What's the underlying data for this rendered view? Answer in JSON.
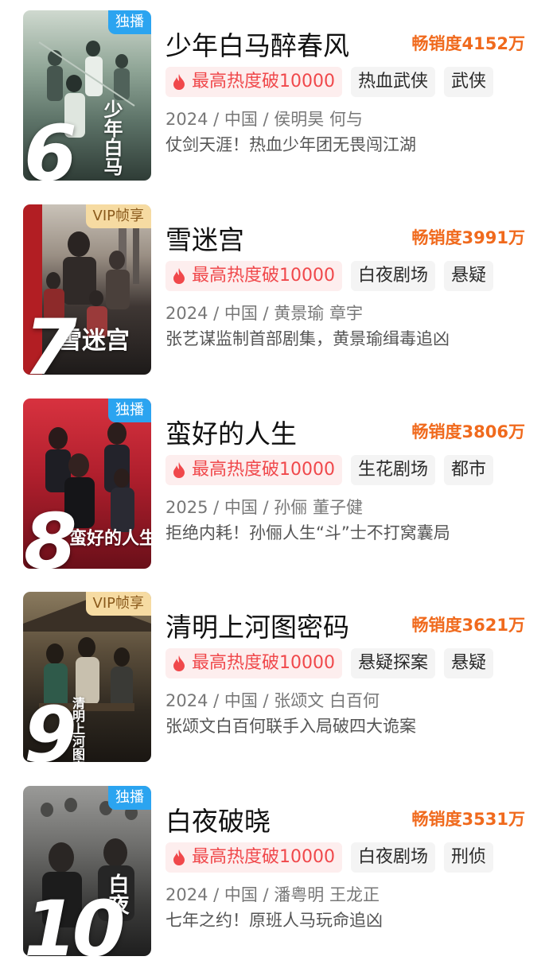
{
  "colors": {
    "sales_orange": "#f06a1d",
    "heat_red": "#f0484b",
    "heat_bg": "#fdeeee",
    "tag_bg": "#f4f4f4",
    "exclusive_blue": "#2ba4f0",
    "vip_gold": "#f6dba2"
  },
  "items": [
    {
      "rank": "6",
      "badge": "独播",
      "poster_title": "少年白马",
      "title": "少年白马醉春风",
      "sales": "畅销度4152万",
      "heat_tag": "最高热度破10000",
      "tags": [
        "热血武侠",
        "武侠"
      ],
      "meta": "2024 / 中国 / 侯明昊 何与",
      "desc": "仗剑天涯！热血少年团无畏闯江湖",
      "icons": {
        "heat": "flame-icon"
      }
    },
    {
      "rank": "7",
      "badge": "VIP帧享",
      "poster_title": "雪迷宫",
      "title": "雪迷宫",
      "sales": "畅销度3991万",
      "heat_tag": "最高热度破10000",
      "tags": [
        "白夜剧场",
        "悬疑"
      ],
      "meta": "2024 / 中国 / 黄景瑜 章宇",
      "desc": "张艺谋监制首部剧集，黄景瑜缉毒追凶",
      "icons": {
        "heat": "flame-icon"
      }
    },
    {
      "rank": "8",
      "badge": "独播",
      "poster_title": "蛮好的人生",
      "title": "蛮好的人生",
      "sales": "畅销度3806万",
      "heat_tag": "最高热度破10000",
      "tags": [
        "生花剧场",
        "都市"
      ],
      "meta": "2025 / 中国 / 孙俪 董子健",
      "desc": "拒绝内耗！孙俪人生“斗”士不打窝囊局",
      "icons": {
        "heat": "flame-icon"
      }
    },
    {
      "rank": "9",
      "badge": "VIP帧享",
      "poster_title": "清明上河图密码",
      "title": "清明上河图密码",
      "sales": "畅销度3621万",
      "heat_tag": "最高热度破10000",
      "tags": [
        "悬疑探案",
        "悬疑"
      ],
      "meta": "2024 / 中国 / 张颂文 白百何",
      "desc": "张颂文白百何联手入局破四大诡案",
      "icons": {
        "heat": "flame-icon"
      }
    },
    {
      "rank": "10",
      "badge": "独播",
      "poster_title": "白夜",
      "title": "白夜破晓",
      "sales": "畅销度3531万",
      "heat_tag": "最高热度破10000",
      "tags": [
        "白夜剧场",
        "刑侦"
      ],
      "meta": "2024 / 中国 / 潘粤明 王龙正",
      "desc": "七年之约！原班人马玩命追凶",
      "icons": {
        "heat": "flame-icon"
      }
    }
  ]
}
